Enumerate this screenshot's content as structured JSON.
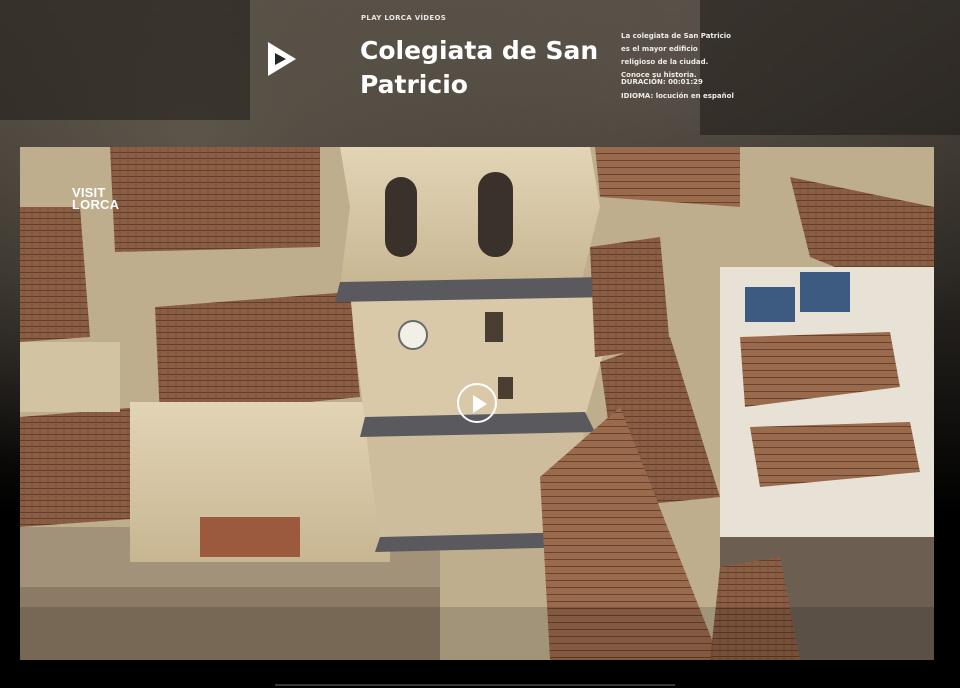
{
  "header": {
    "eyebrow": "PLAY LORCA VÍDEOS",
    "title": "Colegiata de San Patricio",
    "description": "La colegiata de San Patricio es el mayor edificio religioso de la ciudad. Conoce su historia.",
    "duration": "DURACIÓN: 00:01:29",
    "language": "IDIOMA: locución en español",
    "logo_icon": "play-lorca-logo-icon"
  },
  "player": {
    "watermark_line1": "VISIT",
    "watermark_line2": "LORCA",
    "play_icon": "play-icon"
  },
  "colors": {
    "background": "#000000",
    "text": "#ffffff",
    "roof": "#8b5e44",
    "stone": "#d9c9a8"
  }
}
